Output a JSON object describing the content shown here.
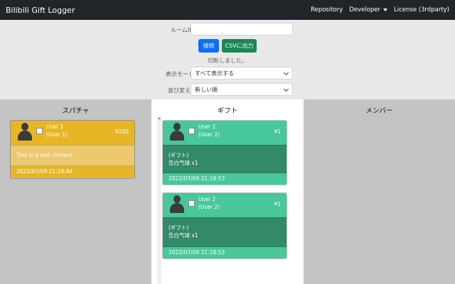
{
  "navbar": {
    "brand": "Bilibili Gift Logger",
    "links": [
      "Repository",
      "Developer",
      "License (3rdparty)"
    ]
  },
  "controls": {
    "room_label": "ルームID",
    "room_value": "",
    "connect_label": "接続",
    "csv_label": "CSVに出力",
    "status": "切断しました。",
    "display_mode_label": "表示モード",
    "display_mode_value": "すべて表示する",
    "sort_label": "並び変え",
    "sort_value": "新しい順"
  },
  "columns": {
    "superchat": {
      "title": "スパチャ",
      "cards": [
        {
          "user": "User 1",
          "user_sub": "(User 1)",
          "amount": "¥100",
          "content": "This is a test content.",
          "time": "2022/07/09 21:18:44"
        }
      ]
    },
    "gift": {
      "title": "ギフト",
      "cards": [
        {
          "user": "User 2",
          "user_sub": "(User 2)",
          "amount": "¥1",
          "content_1": "(ギフト)",
          "content_2": "告白气球 x1",
          "time": "2022/07/09 21:18:53"
        },
        {
          "user": "User 2",
          "user_sub": "(User 2)",
          "amount": "¥1",
          "content_1": "(ギフト)",
          "content_2": "告白气球 x1",
          "time": "2022/07/09 21:18:53"
        }
      ]
    },
    "members": {
      "title": "メンバー"
    }
  },
  "colors": {
    "navbar": "#212529",
    "superchat": "#e6b627",
    "gift": "#48c79a",
    "gift_body": "#328a69",
    "primary": "#0d6efd",
    "success": "#198754"
  }
}
